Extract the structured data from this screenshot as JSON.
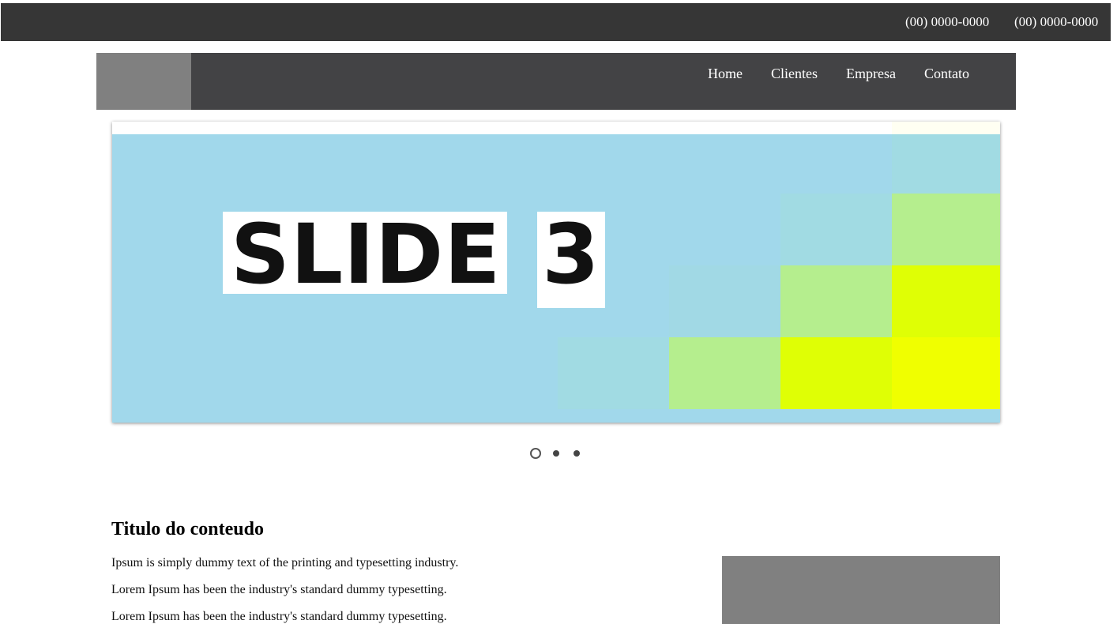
{
  "topbar": {
    "phones": [
      "(00) 0000-0000",
      "(00) 0000-0000"
    ]
  },
  "nav": {
    "items": [
      {
        "label": "Home"
      },
      {
        "label": "Clientes"
      },
      {
        "label": "Empresa"
      },
      {
        "label": "Contato"
      }
    ]
  },
  "slider": {
    "title_word": "SLIDE",
    "title_number": "3",
    "background_color": "#a1d8eb",
    "tile_colors": [
      "#a1dbe3",
      "#b5ee8e",
      "#dfff05",
      "#f0ff00"
    ],
    "dot_count": 3,
    "active_dot": 1
  },
  "content": {
    "title": "Titulo do conteudo",
    "paragraphs": [
      "Ipsum is simply dummy text of the printing and typesetting industry.",
      "Lorem Ipsum has been the industry's standard dummy typesetting.",
      "Lorem Ipsum has been the industry's standard dummy typesetting."
    ]
  }
}
